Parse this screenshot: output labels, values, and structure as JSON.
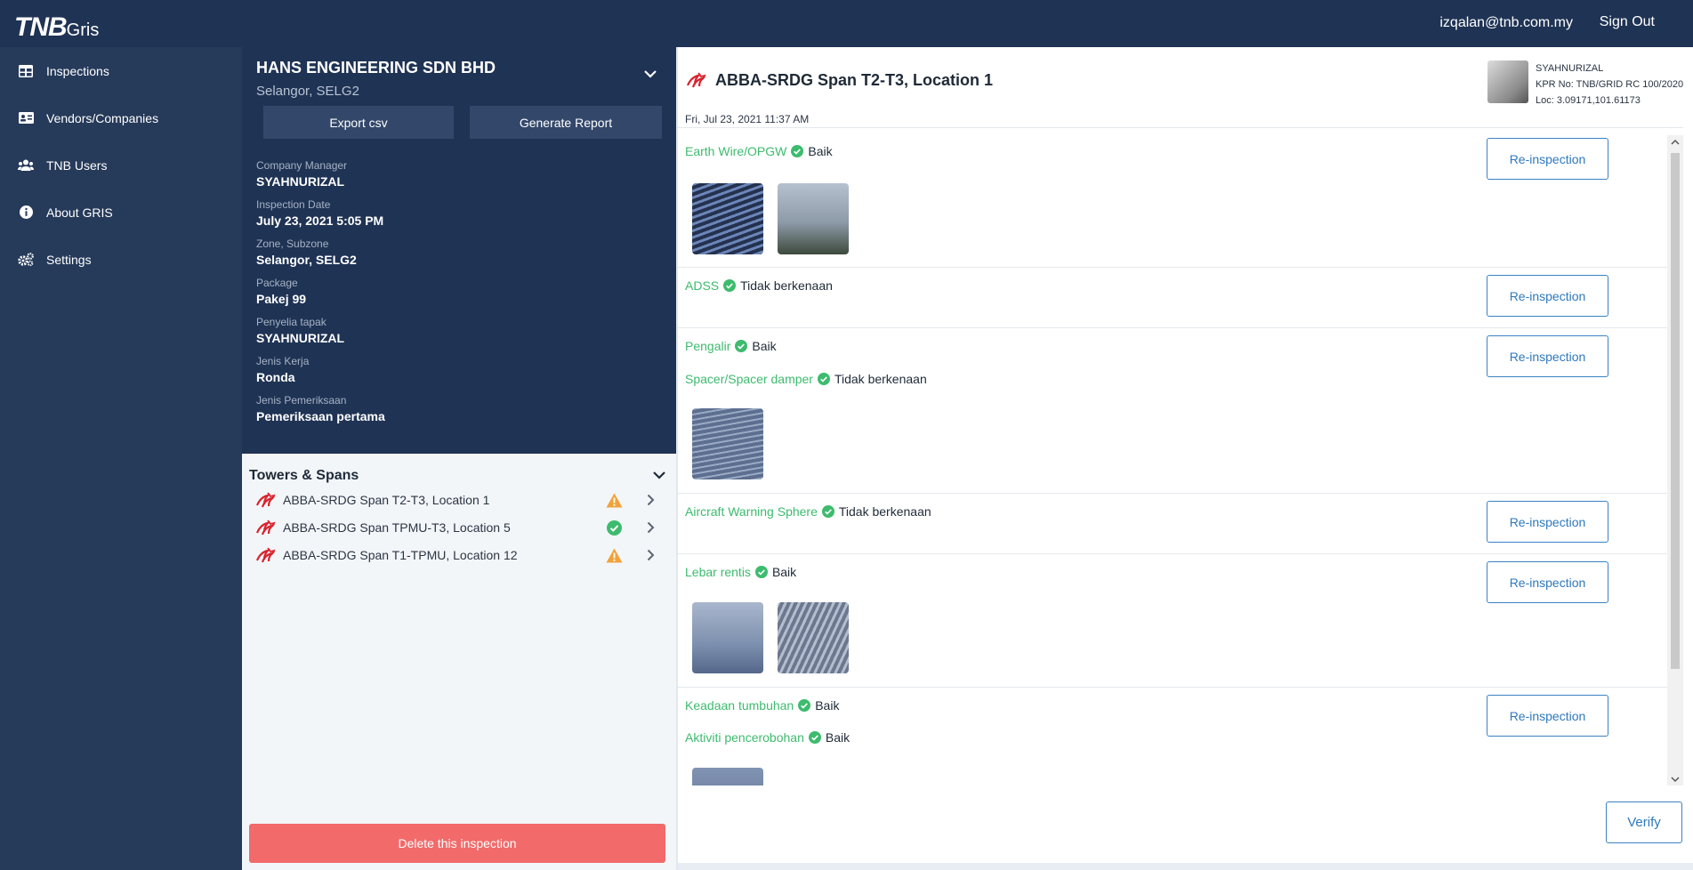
{
  "app": {
    "logo_main": "TNB",
    "logo_sub": "Gris",
    "user_email": "izqalan@tnb.com.my",
    "sign_out": "Sign Out"
  },
  "sidebar": {
    "items": [
      {
        "label": "Inspections",
        "icon": "table-icon"
      },
      {
        "label": "Vendors/Companies",
        "icon": "id-card-icon"
      },
      {
        "label": "TNB Users",
        "icon": "users-icon"
      },
      {
        "label": "About GRIS",
        "icon": "info-icon"
      },
      {
        "label": "Settings",
        "icon": "gears-icon"
      }
    ]
  },
  "company": {
    "name": "HANS ENGINEERING SDN BHD",
    "location": "Selangor, SELG2",
    "export_label": "Export csv",
    "report_label": "Generate Report",
    "fields": [
      {
        "label": "Company Manager",
        "value": "SYAHNURIZAL"
      },
      {
        "label": "Inspection Date",
        "value": "July 23, 2021 5:05 PM"
      },
      {
        "label": "Zone, Subzone",
        "value": "Selangor, SELG2"
      },
      {
        "label": "Package",
        "value": "Pakej 99"
      },
      {
        "label": "Penyelia tapak",
        "value": "SYAHNURIZAL"
      },
      {
        "label": "Jenis Kerja",
        "value": "Ronda"
      },
      {
        "label": "Jenis Pemeriksaan",
        "value": "Pemeriksaan pertama"
      }
    ]
  },
  "towers": {
    "title": "Towers & Spans",
    "items": [
      {
        "label": "ABBA-SRDG Span T2-T3, Location 1",
        "status": "warning"
      },
      {
        "label": "ABBA-SRDG Span TPMU-T3, Location 5",
        "status": "ok"
      },
      {
        "label": "ABBA-SRDG Span T1-TPMU, Location 12",
        "status": "warning"
      }
    ],
    "delete_label": "Delete this inspection"
  },
  "detail": {
    "title": "ABBA-SRDG Span T2-T3, Location 1",
    "date": "Fri, Jul 23, 2021 11:37 AM",
    "inspector": {
      "name": "SYAHNURIZAL",
      "kpr": "KPR No: TNB/GRID RC 100/2020",
      "loc": "Loc: 3.09171,101.61173"
    },
    "reinspect_label": "Re-inspection",
    "verify_label": "Verify",
    "items": [
      {
        "name": "Earth Wire/OPGW",
        "status": "Baik"
      },
      {
        "name": "ADSS",
        "status": "Tidak berkenaan"
      },
      {
        "name": "Pengalir",
        "status": "Baik"
      },
      {
        "name": "Spacer/Spacer damper",
        "status": "Tidak berkenaan"
      },
      {
        "name": "Aircraft Warning Sphere",
        "status": "Tidak berkenaan"
      },
      {
        "name": "Lebar rentis",
        "status": "Baik"
      },
      {
        "name": "Keadaan tumbuhan",
        "status": "Baik"
      },
      {
        "name": "Aktiviti pencerobohan",
        "status": "Baik"
      }
    ]
  },
  "colors": {
    "navy": "#1f3354",
    "green": "#3dbb6e",
    "warning": "#f0a33a",
    "danger": "#f26a6a",
    "blue": "#2f78bd"
  }
}
